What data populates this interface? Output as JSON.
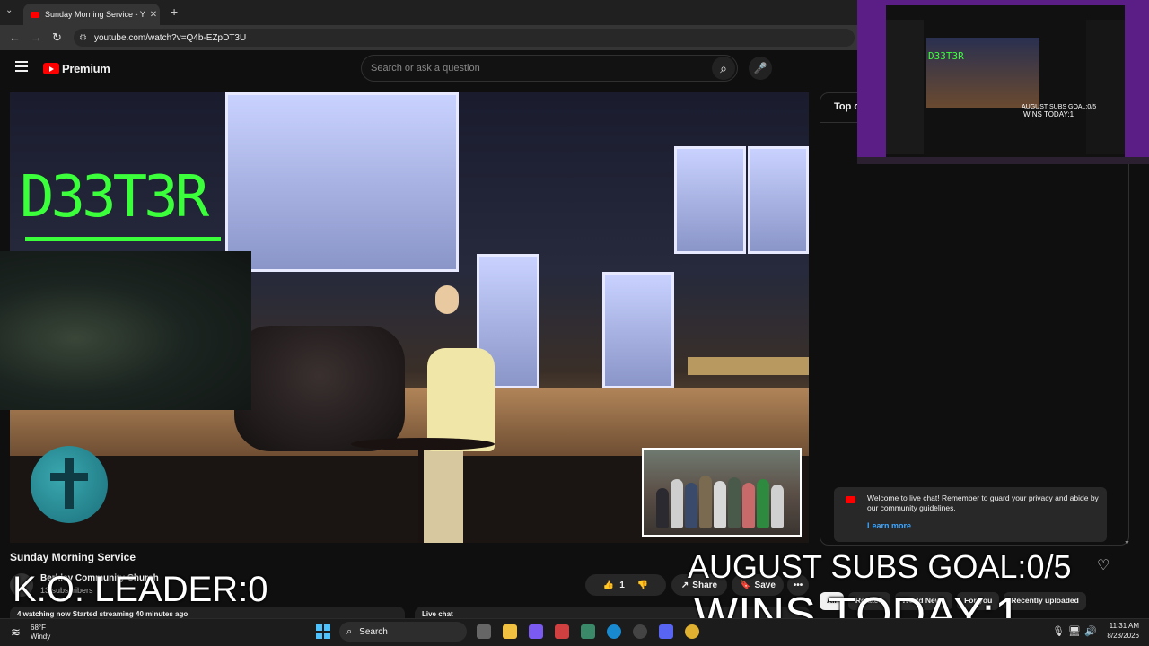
{
  "browser": {
    "tab_title": "Sunday Morning Service - Y",
    "new_tab_symbol": "+",
    "url": "youtube.com/watch?v=Q4b-EZpDT3U"
  },
  "youtube": {
    "logo_text": "Premium",
    "search_placeholder": "Search or ask a question"
  },
  "video": {
    "overlay_brand": "D33T3R",
    "title": "Sunday Morning Service",
    "channel_name": "Berkley Community Church",
    "subscribers": "13 subscribers",
    "like_count": "1",
    "share_label": "Share",
    "save_label": "Save",
    "more_symbol": "•••",
    "description_preview": "4 watching now  Started streaming 40 minutes ago",
    "livechat_label": "Live chat"
  },
  "chat": {
    "header": "Top chat",
    "welcome_text": "Welcome to live chat! Remember to guard your privacy and abide by our community guidelines.",
    "learn_more": "Learn more"
  },
  "chips": [
    "All",
    "Related",
    "World News",
    "For you",
    "Recently uploaded"
  ],
  "stream_overlay": {
    "ko_leader": "K.O. LEADER:0",
    "subs_goal": "AUGUST SUBS GOAL:0/5",
    "wins_today": "WINS TODAY:1",
    "mini_subs_goal": "AUGUST SUBS GOAL:0/5",
    "mini_wins": "WINS TODAY:1",
    "mini_brand": "D33T3R"
  },
  "taskbar": {
    "weather_temp": "68°F",
    "weather_desc": "Windy",
    "search_label": "Search",
    "time": "11:31 AM",
    "date": "8/23/2026"
  },
  "colors": {
    "brand_green": "#3cff3c",
    "youtube_red": "#ff0000",
    "link_blue": "#3ea6ff",
    "overlay_purple": "#5a1e86"
  }
}
